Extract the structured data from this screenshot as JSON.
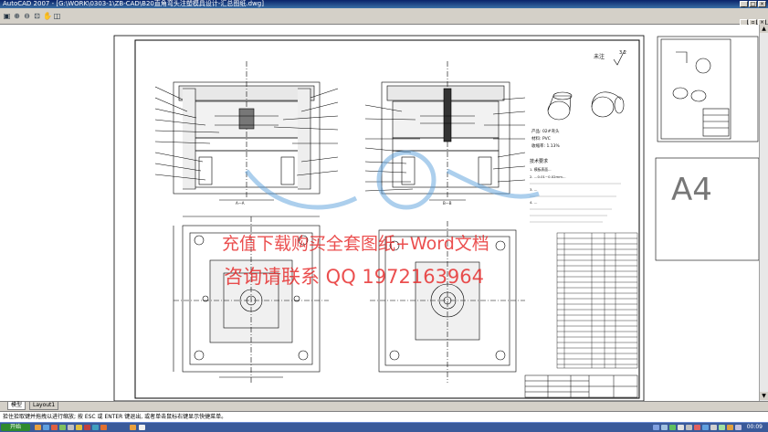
{
  "window": {
    "title": "AutoCAD 2007 - [G:\\WORK\\0303-1\\ZB-CAD\\B20直角弯头注塑模具设计-汇总图纸.dwg]"
  },
  "toolbar": {
    "icons": [
      "folder-open-icon",
      "zoom-in-icon",
      "zoom-out-icon",
      "zoom-window-icon",
      "pan-icon",
      "zoom-extents-icon"
    ]
  },
  "drawing": {
    "note_title": "未注",
    "roughness_mark": "3.2",
    "part_lines": [
      "产品: 02#弯头",
      "材料: PVC",
      "收缩率: 1.13%"
    ],
    "tech_title": "技术要求",
    "tech_items": [
      "1.  模板表面...",
      "2.  ...0.01~0.02mm...",
      "3.  ...",
      "4.  ..."
    ],
    "section_a_label": "A—A",
    "section_b_label": "B—B",
    "sheet_label": "A4"
  },
  "watermarks": {
    "line1": "充值下载购买全套图纸+Word文档",
    "line2": "咨询请联系 QQ 1972163964"
  },
  "layout_tabs": [
    "模型",
    "Layout1"
  ],
  "command_line": "拾住拾取键并拖拽以进行缩放; 按 ESC 或 ENTER 键退出, 或者单击鼠标右键显示快捷菜单。",
  "taskbar": {
    "start_label": "开始",
    "clock": "00:09"
  }
}
